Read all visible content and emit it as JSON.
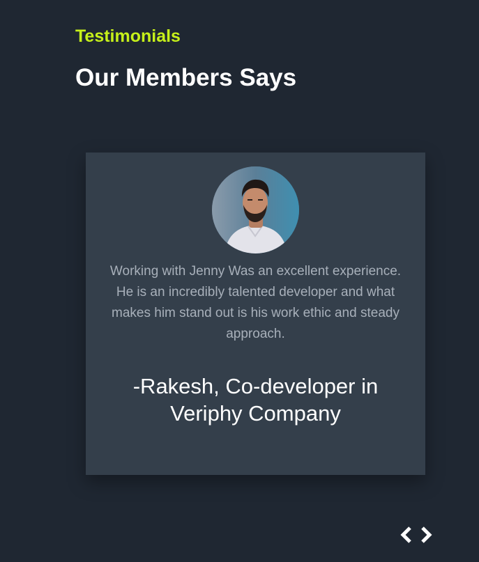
{
  "section": {
    "eyebrow": "Testimonials",
    "title": "Our Members Says"
  },
  "testimonial": {
    "avatar_icon": "person-portrait",
    "quote": "Working with Jenny Was an excellent experience. He is an incredibly talented developer and what makes him stand out is his work ethic and steady approach.",
    "author": "-Rakesh, Co-developer in Veriphy Company"
  },
  "carousel": {
    "prev_icon": "chevron-left-icon",
    "next_icon": "chevron-right-icon"
  },
  "colors": {
    "background": "#1f2732",
    "card": "#343f4b",
    "accent": "#c6f01a",
    "quote_text": "#a8b0ba",
    "heading_text": "#ffffff"
  }
}
